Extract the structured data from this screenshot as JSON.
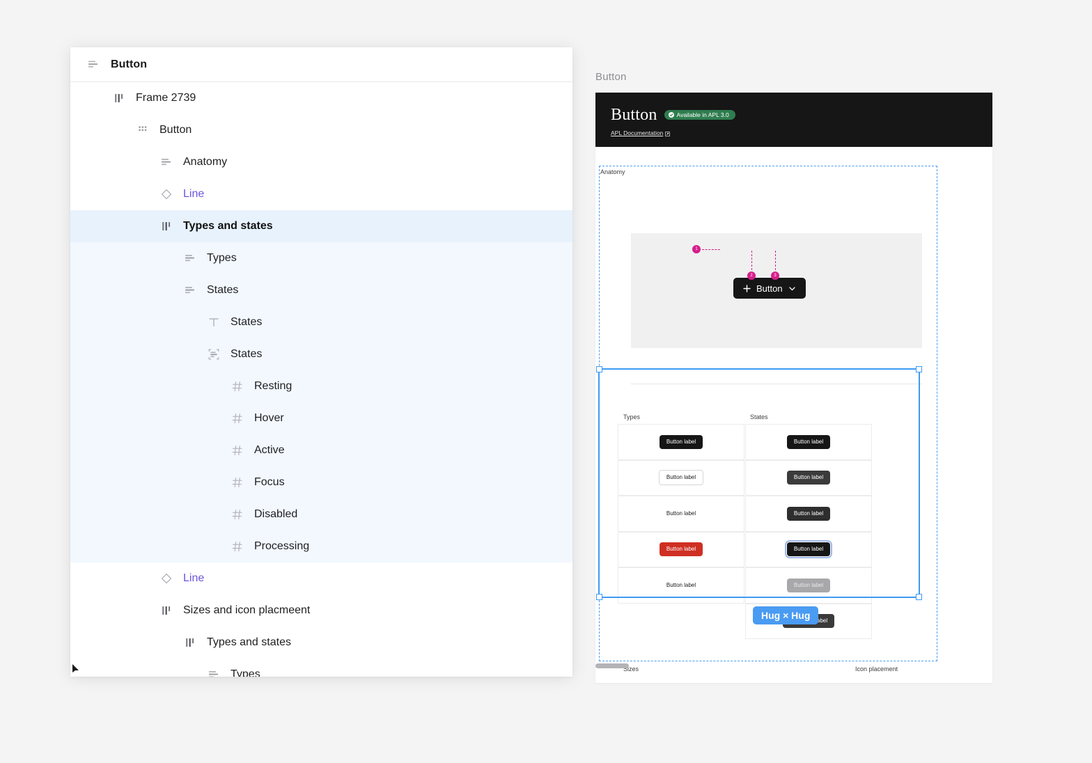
{
  "layers_panel": {
    "header": {
      "icon": "text-frame-icon",
      "title": "Button"
    },
    "rows": [
      {
        "label": "Frame 2739",
        "icon": "component-set-icon",
        "indent": 0,
        "type": "frame",
        "state": "normal"
      },
      {
        "label": "Button",
        "icon": "component-icon",
        "indent": 1,
        "type": "component",
        "state": "normal"
      },
      {
        "label": "Anatomy",
        "icon": "text-frame-icon",
        "indent": 2,
        "type": "frame",
        "state": "normal"
      },
      {
        "label": "Line",
        "icon": "diamond-icon",
        "indent": 2,
        "type": "instance",
        "state": "normal"
      },
      {
        "label": "Types and states",
        "icon": "component-set-icon",
        "indent": 2,
        "type": "frame",
        "state": "selected"
      },
      {
        "label": "Types",
        "icon": "text-frame-icon",
        "indent": 3,
        "type": "frame",
        "state": "child"
      },
      {
        "label": "States",
        "icon": "text-frame-icon",
        "indent": 3,
        "type": "frame",
        "state": "child"
      },
      {
        "label": "States",
        "icon": "text-icon",
        "indent": 4,
        "type": "text",
        "state": "child"
      },
      {
        "label": "States",
        "icon": "auto-layout-icon",
        "indent": 4,
        "type": "frame",
        "state": "child"
      },
      {
        "label": "Resting",
        "icon": "hash-icon",
        "indent": 5,
        "type": "section",
        "state": "child"
      },
      {
        "label": "Hover",
        "icon": "hash-icon",
        "indent": 5,
        "type": "section",
        "state": "child"
      },
      {
        "label": "Active",
        "icon": "hash-icon",
        "indent": 5,
        "type": "section",
        "state": "child"
      },
      {
        "label": "Focus",
        "icon": "hash-icon",
        "indent": 5,
        "type": "section",
        "state": "child"
      },
      {
        "label": "Disabled",
        "icon": "hash-icon",
        "indent": 5,
        "type": "section",
        "state": "child"
      },
      {
        "label": "Processing",
        "icon": "hash-icon",
        "indent": 5,
        "type": "section",
        "state": "child"
      },
      {
        "label": "Line",
        "icon": "diamond-icon",
        "indent": 2,
        "type": "instance",
        "state": "normal"
      },
      {
        "label": "Sizes and icon placmeent",
        "icon": "component-set-icon",
        "indent": 2,
        "type": "frame",
        "state": "normal"
      },
      {
        "label": "Types and states",
        "icon": "component-set-icon",
        "indent": 3,
        "type": "frame",
        "state": "normal"
      },
      {
        "label": "Types",
        "icon": "text-frame-icon",
        "indent": 4,
        "type": "frame",
        "state": "normal"
      }
    ]
  },
  "canvas": {
    "page_title": "Button",
    "hero": {
      "title": "Button",
      "badge": "Available in APL 3.0",
      "badge_icon": "check-circle-icon",
      "badge_color": "#2f7d4f",
      "link": "APL Documentation",
      "link_icon": "external-link-icon",
      "background": "#161616"
    },
    "anatomy": {
      "label": "Anatomy",
      "button_label": "Button",
      "leading_icon": "plus-icon",
      "trailing_icon": "chevron-down-icon",
      "annotations": [
        "1",
        "2",
        "3"
      ],
      "annotation_color": "#d61f8c"
    },
    "types_and_states": {
      "types_label": "Types",
      "states_label": "States",
      "selection_color": "#3d9bf5",
      "types": [
        {
          "label": "Button label",
          "variant": "primary"
        },
        {
          "label": "Button label",
          "variant": "outline"
        },
        {
          "label": "Button label",
          "variant": "text"
        },
        {
          "label": "Button label",
          "variant": "danger"
        },
        {
          "label": "Button label",
          "variant": "text"
        }
      ],
      "states": [
        {
          "label": "Button label",
          "variant": "resting"
        },
        {
          "label": "Button label",
          "variant": "hover"
        },
        {
          "label": "Button label",
          "variant": "active"
        },
        {
          "label": "Button label",
          "variant": "focus"
        },
        {
          "label": "Button label",
          "variant": "disabled"
        },
        {
          "label": "Button label",
          "variant": "processing",
          "icon": "spinner-icon"
        }
      ]
    },
    "size_badge": {
      "text": "Hug × Hug",
      "color": "#4a9bf2"
    },
    "bottom_sections": [
      {
        "label": "Sizes"
      },
      {
        "label": "Icon placement"
      }
    ]
  }
}
